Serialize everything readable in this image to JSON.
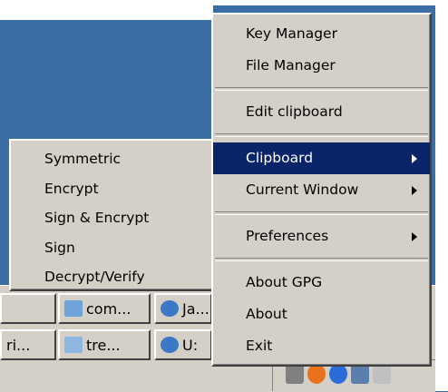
{
  "main_menu": {
    "items": [
      {
        "label": "Key Manager"
      },
      {
        "label": "File Manager"
      },
      {
        "label": "Edit clipboard"
      },
      {
        "label": "Clipboard"
      },
      {
        "label": "Current Window"
      },
      {
        "label": "Preferences"
      },
      {
        "label": "About GPG"
      },
      {
        "label": "About"
      },
      {
        "label": "Exit"
      }
    ]
  },
  "submenu": {
    "items": [
      {
        "label": "Symmetric"
      },
      {
        "label": "Encrypt"
      },
      {
        "label": "Sign & Encrypt"
      },
      {
        "label": "Sign"
      },
      {
        "label": "Decrypt/Verify"
      }
    ]
  },
  "taskbar": {
    "buttons": [
      {
        "label": "com...",
        "icon": "explorer-icon"
      },
      {
        "label": "Ja...",
        "icon": "ie-icon"
      },
      {
        "label": "ri...",
        "icon": "window-icon"
      },
      {
        "label": "tre...",
        "icon": "notepad-icon"
      },
      {
        "label": "U:",
        "icon": "ie-icon"
      }
    ]
  },
  "tray": {
    "icons": [
      "network-icon",
      "firefox-icon",
      "messenger-icon",
      "display-icon",
      "volume-icon"
    ]
  },
  "colors": {
    "desktop": "#3a6ea5",
    "menu_bg": "#d4d0c8",
    "highlight": "#0a246a"
  }
}
